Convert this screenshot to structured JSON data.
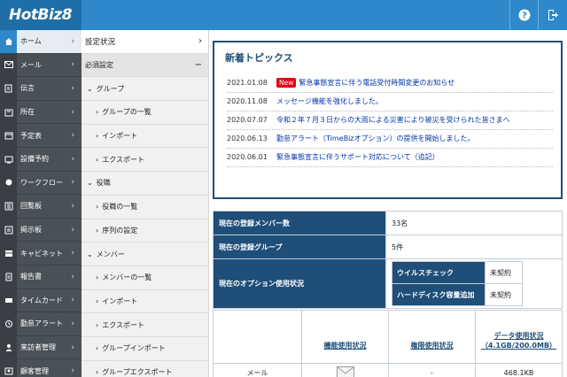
{
  "app": {
    "logo": "HotBiz8"
  },
  "header": {
    "help_icon": "question-circle-icon",
    "logout_icon": "logout-icon"
  },
  "nav": {
    "items": [
      {
        "label": "ホーム",
        "icon": "home-icon",
        "active": true
      },
      {
        "label": "メール",
        "icon": "mail-icon"
      },
      {
        "label": "伝言",
        "icon": "memo-icon"
      },
      {
        "label": "所在",
        "icon": "location-icon"
      },
      {
        "label": "予定表",
        "icon": "calendar-icon"
      },
      {
        "label": "設備予約",
        "icon": "equipment-icon"
      },
      {
        "label": "ワークフロー",
        "icon": "workflow-icon"
      },
      {
        "label": "回覧板",
        "icon": "circular-icon"
      },
      {
        "label": "掲示板",
        "icon": "bulletin-icon"
      },
      {
        "label": "キャビネット",
        "icon": "cabinet-icon"
      },
      {
        "label": "報告書",
        "icon": "report-icon"
      },
      {
        "label": "タイムカード",
        "icon": "timecard-icon"
      },
      {
        "label": "勤怠アラート",
        "icon": "alert-icon"
      },
      {
        "label": "来訪者管理",
        "icon": "visitor-icon"
      },
      {
        "label": "顧客管理",
        "icon": "customer-icon"
      }
    ]
  },
  "submenu": {
    "top": "設定状況",
    "section": "必須設定",
    "groups": [
      {
        "label": "グループ",
        "children": [
          "グループの一覧",
          "インポート",
          "エクスポート"
        ]
      },
      {
        "label": "役職",
        "children": [
          "役職の一覧",
          "序列の設定"
        ]
      },
      {
        "label": "メンバー",
        "children": [
          "メンバーの一覧",
          "インポート",
          "エクスポート",
          "グループインポート",
          "グループエクスポート"
        ]
      }
    ]
  },
  "topics": {
    "title": "新着トピックス",
    "badge": "New",
    "items": [
      {
        "date": "2021.01.08",
        "text": "緊急事態宣言に伴う電話受付時間変更のお知らせ",
        "new": true
      },
      {
        "date": "2020.11.08",
        "text": "メッセージ機能を強化しました。"
      },
      {
        "date": "2020.07.07",
        "text": "令和２年７月３日からの大雨による災害により被災を受けられた皆さまへ"
      },
      {
        "date": "2020.06.13",
        "text": "勤怠アラート（TimeBizオプション）の提供を開始しました。"
      },
      {
        "date": "2020.06.01",
        "text": "緊急事態宣言に伴うサポート対応について（追記）"
      }
    ]
  },
  "info": {
    "members_label": "現在の登録メンバー数",
    "members_value": "33名",
    "groups_label": "現在の登録グループ",
    "groups_value": "5件",
    "options_label": "現在のオプション使用状況",
    "options": [
      {
        "name": "ウイルスチェック",
        "status": "未契約"
      },
      {
        "name": "ハードディスク容量追加",
        "status": "未契約"
      }
    ]
  },
  "usage": {
    "headers": [
      "",
      "機能使用状況",
      "権限使用状況",
      "データ使用状況（4.1GB/200.0MB）"
    ],
    "rows": [
      {
        "name": "メール",
        "icon": "envelope-icon",
        "permission": "-",
        "data": "468.1KB"
      }
    ]
  }
}
